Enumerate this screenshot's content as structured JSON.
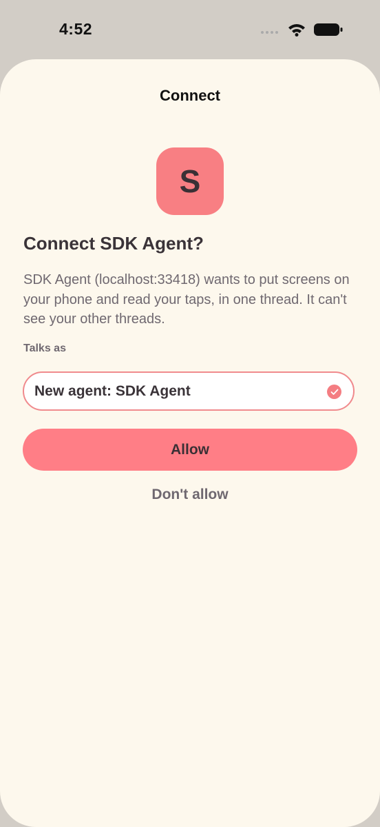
{
  "status_bar": {
    "time": "4:52",
    "icons": [
      "cellular-signal-icon",
      "wifi-icon",
      "battery-icon"
    ]
  },
  "sheet": {
    "title": "Connect",
    "app_icon_letter": "S",
    "heading": "Connect SDK Agent?",
    "description": "SDK Agent (localhost:33418) wants to put screens on your phone and read your taps, in one thread. It can't see your other threads.",
    "talks_as_label": "Talks as",
    "talks_as_value": "New agent: SDK Agent",
    "allow_label": "Allow",
    "deny_label": "Don't allow"
  },
  "colors": {
    "background": "#d2cdc6",
    "sheet": "#fdf8ed",
    "accent": "#ff7e86",
    "text_primary": "#3a3338",
    "text_secondary": "#6f6870"
  }
}
